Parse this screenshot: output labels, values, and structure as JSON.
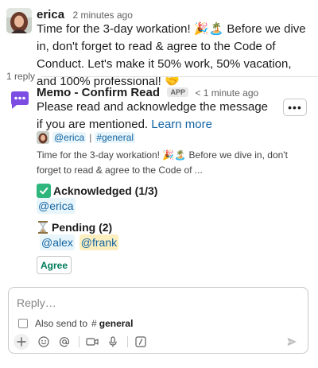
{
  "message1": {
    "author": "erica",
    "time": "2 minutes ago",
    "text_part1": "Time for the 3-day workation!",
    "text_part2": "Before we dive in, don't forget to read & agree to the Code of Conduct. Let's make it 50% work, 50% vacation, and 100% professional!"
  },
  "thread": {
    "reply_count": "1 reply"
  },
  "app_message": {
    "author": "Memo - Confirm Read",
    "badge": "APP",
    "time": "< 1 minute ago",
    "text": "Please read and acknowledge the message if you are mentioned.",
    "link": "Learn more",
    "more_label": "•••",
    "quote": {
      "user_mention": "@erica",
      "separator": "|",
      "channel_mention": "#general",
      "text_part1": "Time for the 3-day workation!",
      "text_part2": "Before we dive in, don't forget to read & agree to the Code of ..."
    },
    "acknowledged": {
      "title": "Acknowledged (1/3)",
      "users": [
        "@erica"
      ]
    },
    "pending": {
      "title": "Pending (2)",
      "users": [
        "@alex",
        "@frank"
      ]
    },
    "agree_button": "Agree"
  },
  "composer": {
    "placeholder": "Reply…",
    "also_send_label": "Also send to",
    "channel": "general"
  },
  "colors": {
    "link": "#1264a3",
    "mention_bg": "#e8f5fa",
    "mention_highlight_bg": "#fcefbf",
    "agree_text": "#007a5a",
    "app_avatar": "#7b4de3"
  }
}
